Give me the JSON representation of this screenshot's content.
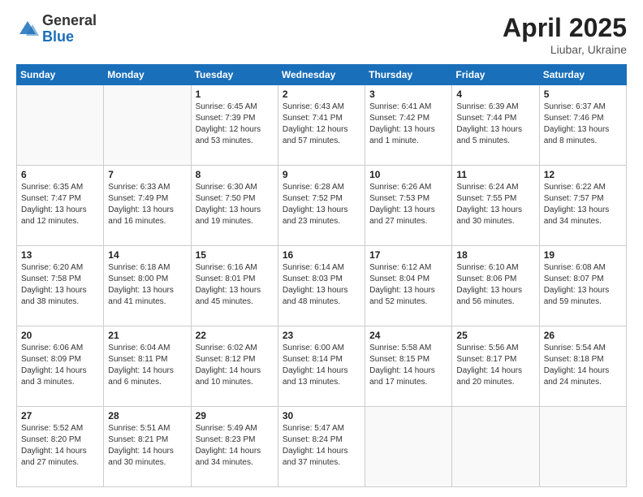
{
  "header": {
    "logo_general": "General",
    "logo_blue": "Blue",
    "title": "April 2025",
    "location": "Liubar, Ukraine"
  },
  "days_of_week": [
    "Sunday",
    "Monday",
    "Tuesday",
    "Wednesday",
    "Thursday",
    "Friday",
    "Saturday"
  ],
  "weeks": [
    [
      {
        "day": "",
        "info": ""
      },
      {
        "day": "",
        "info": ""
      },
      {
        "day": "1",
        "info": "Sunrise: 6:45 AM\nSunset: 7:39 PM\nDaylight: 12 hours and 53 minutes."
      },
      {
        "day": "2",
        "info": "Sunrise: 6:43 AM\nSunset: 7:41 PM\nDaylight: 12 hours and 57 minutes."
      },
      {
        "day": "3",
        "info": "Sunrise: 6:41 AM\nSunset: 7:42 PM\nDaylight: 13 hours and 1 minute."
      },
      {
        "day": "4",
        "info": "Sunrise: 6:39 AM\nSunset: 7:44 PM\nDaylight: 13 hours and 5 minutes."
      },
      {
        "day": "5",
        "info": "Sunrise: 6:37 AM\nSunset: 7:46 PM\nDaylight: 13 hours and 8 minutes."
      }
    ],
    [
      {
        "day": "6",
        "info": "Sunrise: 6:35 AM\nSunset: 7:47 PM\nDaylight: 13 hours and 12 minutes."
      },
      {
        "day": "7",
        "info": "Sunrise: 6:33 AM\nSunset: 7:49 PM\nDaylight: 13 hours and 16 minutes."
      },
      {
        "day": "8",
        "info": "Sunrise: 6:30 AM\nSunset: 7:50 PM\nDaylight: 13 hours and 19 minutes."
      },
      {
        "day": "9",
        "info": "Sunrise: 6:28 AM\nSunset: 7:52 PM\nDaylight: 13 hours and 23 minutes."
      },
      {
        "day": "10",
        "info": "Sunrise: 6:26 AM\nSunset: 7:53 PM\nDaylight: 13 hours and 27 minutes."
      },
      {
        "day": "11",
        "info": "Sunrise: 6:24 AM\nSunset: 7:55 PM\nDaylight: 13 hours and 30 minutes."
      },
      {
        "day": "12",
        "info": "Sunrise: 6:22 AM\nSunset: 7:57 PM\nDaylight: 13 hours and 34 minutes."
      }
    ],
    [
      {
        "day": "13",
        "info": "Sunrise: 6:20 AM\nSunset: 7:58 PM\nDaylight: 13 hours and 38 minutes."
      },
      {
        "day": "14",
        "info": "Sunrise: 6:18 AM\nSunset: 8:00 PM\nDaylight: 13 hours and 41 minutes."
      },
      {
        "day": "15",
        "info": "Sunrise: 6:16 AM\nSunset: 8:01 PM\nDaylight: 13 hours and 45 minutes."
      },
      {
        "day": "16",
        "info": "Sunrise: 6:14 AM\nSunset: 8:03 PM\nDaylight: 13 hours and 48 minutes."
      },
      {
        "day": "17",
        "info": "Sunrise: 6:12 AM\nSunset: 8:04 PM\nDaylight: 13 hours and 52 minutes."
      },
      {
        "day": "18",
        "info": "Sunrise: 6:10 AM\nSunset: 8:06 PM\nDaylight: 13 hours and 56 minutes."
      },
      {
        "day": "19",
        "info": "Sunrise: 6:08 AM\nSunset: 8:07 PM\nDaylight: 13 hours and 59 minutes."
      }
    ],
    [
      {
        "day": "20",
        "info": "Sunrise: 6:06 AM\nSunset: 8:09 PM\nDaylight: 14 hours and 3 minutes."
      },
      {
        "day": "21",
        "info": "Sunrise: 6:04 AM\nSunset: 8:11 PM\nDaylight: 14 hours and 6 minutes."
      },
      {
        "day": "22",
        "info": "Sunrise: 6:02 AM\nSunset: 8:12 PM\nDaylight: 14 hours and 10 minutes."
      },
      {
        "day": "23",
        "info": "Sunrise: 6:00 AM\nSunset: 8:14 PM\nDaylight: 14 hours and 13 minutes."
      },
      {
        "day": "24",
        "info": "Sunrise: 5:58 AM\nSunset: 8:15 PM\nDaylight: 14 hours and 17 minutes."
      },
      {
        "day": "25",
        "info": "Sunrise: 5:56 AM\nSunset: 8:17 PM\nDaylight: 14 hours and 20 minutes."
      },
      {
        "day": "26",
        "info": "Sunrise: 5:54 AM\nSunset: 8:18 PM\nDaylight: 14 hours and 24 minutes."
      }
    ],
    [
      {
        "day": "27",
        "info": "Sunrise: 5:52 AM\nSunset: 8:20 PM\nDaylight: 14 hours and 27 minutes."
      },
      {
        "day": "28",
        "info": "Sunrise: 5:51 AM\nSunset: 8:21 PM\nDaylight: 14 hours and 30 minutes."
      },
      {
        "day": "29",
        "info": "Sunrise: 5:49 AM\nSunset: 8:23 PM\nDaylight: 14 hours and 34 minutes."
      },
      {
        "day": "30",
        "info": "Sunrise: 5:47 AM\nSunset: 8:24 PM\nDaylight: 14 hours and 37 minutes."
      },
      {
        "day": "",
        "info": ""
      },
      {
        "day": "",
        "info": ""
      },
      {
        "day": "",
        "info": ""
      }
    ]
  ]
}
